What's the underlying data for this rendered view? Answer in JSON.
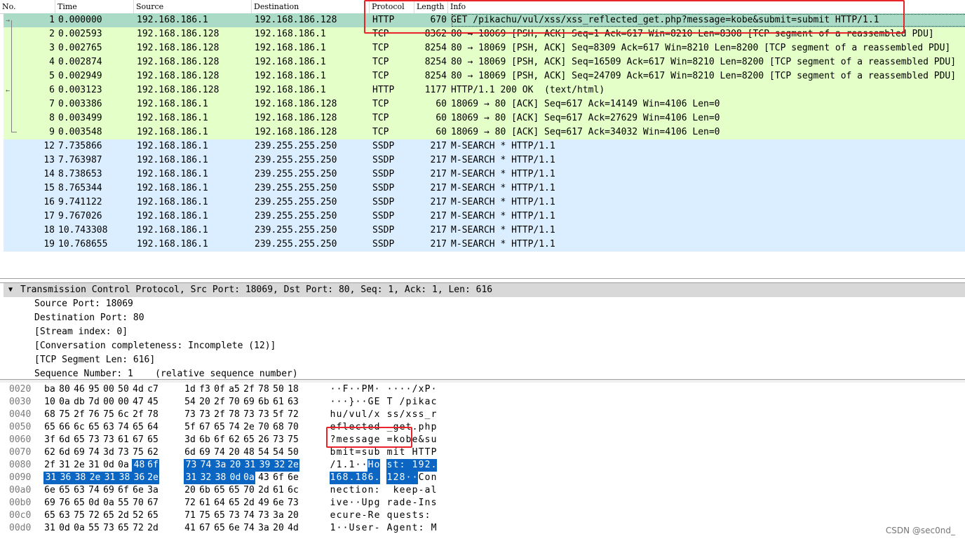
{
  "packet_list": {
    "columns": [
      "No.",
      "Time",
      "Source",
      "Destination",
      "Protocol",
      "Length",
      "Info"
    ],
    "rows": [
      {
        "no": "1",
        "time": "0.000000",
        "src": "192.168.186.1",
        "dst": "192.168.186.128",
        "proto": "HTTP",
        "len": "670",
        "info": "GET /pikachu/vul/xss/xss_reflected_get.php?message=kobe&submit=submit HTTP/1.1",
        "kind": "http-sel"
      },
      {
        "no": "2",
        "time": "0.002593",
        "src": "192.168.186.128",
        "dst": "192.168.186.1",
        "proto": "TCP",
        "len": "8362",
        "info": "80 → 18069 [PSH, ACK] Seq=1 Ack=617 Win=8210 Len=8308 [TCP segment of a reassembled PDU]",
        "kind": "tcp"
      },
      {
        "no": "3",
        "time": "0.002765",
        "src": "192.168.186.128",
        "dst": "192.168.186.1",
        "proto": "TCP",
        "len": "8254",
        "info": "80 → 18069 [PSH, ACK] Seq=8309 Ack=617 Win=8210 Len=8200 [TCP segment of a reassembled PDU]",
        "kind": "tcp"
      },
      {
        "no": "4",
        "time": "0.002874",
        "src": "192.168.186.128",
        "dst": "192.168.186.1",
        "proto": "TCP",
        "len": "8254",
        "info": "80 → 18069 [PSH, ACK] Seq=16509 Ack=617 Win=8210 Len=8200 [TCP segment of a reassembled PDU]",
        "kind": "tcp"
      },
      {
        "no": "5",
        "time": "0.002949",
        "src": "192.168.186.128",
        "dst": "192.168.186.1",
        "proto": "TCP",
        "len": "8254",
        "info": "80 → 18069 [PSH, ACK] Seq=24709 Ack=617 Win=8210 Len=8200 [TCP segment of a reassembled PDU]",
        "kind": "tcp"
      },
      {
        "no": "6",
        "time": "0.003123",
        "src": "192.168.186.128",
        "dst": "192.168.186.1",
        "proto": "HTTP",
        "len": "1177",
        "info": "HTTP/1.1 200 OK  (text/html)",
        "kind": "tcp"
      },
      {
        "no": "7",
        "time": "0.003386",
        "src": "192.168.186.1",
        "dst": "192.168.186.128",
        "proto": "TCP",
        "len": "60",
        "info": "18069 → 80 [ACK] Seq=617 Ack=14149 Win=4106 Len=0",
        "kind": "tcp"
      },
      {
        "no": "8",
        "time": "0.003499",
        "src": "192.168.186.1",
        "dst": "192.168.186.128",
        "proto": "TCP",
        "len": "60",
        "info": "18069 → 80 [ACK] Seq=617 Ack=27629 Win=4106 Len=0",
        "kind": "tcp"
      },
      {
        "no": "9",
        "time": "0.003548",
        "src": "192.168.186.1",
        "dst": "192.168.186.128",
        "proto": "TCP",
        "len": "60",
        "info": "18069 → 80 [ACK] Seq=617 Ack=34032 Win=4106 Len=0",
        "kind": "tcp"
      },
      {
        "no": "12",
        "time": "7.735866",
        "src": "192.168.186.1",
        "dst": "239.255.255.250",
        "proto": "SSDP",
        "len": "217",
        "info": "M-SEARCH * HTTP/1.1",
        "kind": "ssdp"
      },
      {
        "no": "13",
        "time": "7.763987",
        "src": "192.168.186.1",
        "dst": "239.255.255.250",
        "proto": "SSDP",
        "len": "217",
        "info": "M-SEARCH * HTTP/1.1",
        "kind": "ssdp"
      },
      {
        "no": "14",
        "time": "8.738653",
        "src": "192.168.186.1",
        "dst": "239.255.255.250",
        "proto": "SSDP",
        "len": "217",
        "info": "M-SEARCH * HTTP/1.1",
        "kind": "ssdp"
      },
      {
        "no": "15",
        "time": "8.765344",
        "src": "192.168.186.1",
        "dst": "239.255.255.250",
        "proto": "SSDP",
        "len": "217",
        "info": "M-SEARCH * HTTP/1.1",
        "kind": "ssdp"
      },
      {
        "no": "16",
        "time": "9.741122",
        "src": "192.168.186.1",
        "dst": "239.255.255.250",
        "proto": "SSDP",
        "len": "217",
        "info": "M-SEARCH * HTTP/1.1",
        "kind": "ssdp"
      },
      {
        "no": "17",
        "time": "9.767026",
        "src": "192.168.186.1",
        "dst": "239.255.255.250",
        "proto": "SSDP",
        "len": "217",
        "info": "M-SEARCH * HTTP/1.1",
        "kind": "ssdp"
      },
      {
        "no": "18",
        "time": "10.743308",
        "src": "192.168.186.1",
        "dst": "239.255.255.250",
        "proto": "SSDP",
        "len": "217",
        "info": "M-SEARCH * HTTP/1.1",
        "kind": "ssdp"
      },
      {
        "no": "19",
        "time": "10.768655",
        "src": "192.168.186.1",
        "dst": "239.255.255.250",
        "proto": "SSDP",
        "len": "217",
        "info": "M-SEARCH * HTTP/1.1",
        "kind": "ssdp"
      }
    ]
  },
  "details": {
    "title": "Transmission Control Protocol, Src Port: 18069, Dst Port: 80, Seq: 1, Ack: 1, Len: 616",
    "expand_icon": "chevron-down-icon",
    "lines": [
      "Source Port: 18069",
      "Destination Port: 80",
      "[Stream index: 0]",
      "[Conversation completeness: Incomplete (12)]",
      "[TCP Segment Len: 616]",
      "Sequence Number: 1    (relative sequence number)"
    ]
  },
  "hex": {
    "rows": [
      {
        "off": "0020",
        "bytes": [
          "ba",
          "80",
          "46",
          "95",
          "00",
          "50",
          "4d",
          "c7",
          "1d",
          "f3",
          "0f",
          "a5",
          "2f",
          "78",
          "50",
          "18"
        ],
        "ascii": "··F··PM· ····/xP·"
      },
      {
        "off": "0030",
        "bytes": [
          "10",
          "0a",
          "db",
          "7d",
          "00",
          "00",
          "47",
          "45",
          "54",
          "20",
          "2f",
          "70",
          "69",
          "6b",
          "61",
          "63"
        ],
        "ascii": "···}··GE T /pikac"
      },
      {
        "off": "0040",
        "bytes": [
          "68",
          "75",
          "2f",
          "76",
          "75",
          "6c",
          "2f",
          "78",
          "73",
          "73",
          "2f",
          "78",
          "73",
          "73",
          "5f",
          "72"
        ],
        "ascii": "hu/vul/x ss/xss_r"
      },
      {
        "off": "0050",
        "bytes": [
          "65",
          "66",
          "6c",
          "65",
          "63",
          "74",
          "65",
          "64",
          "5f",
          "67",
          "65",
          "74",
          "2e",
          "70",
          "68",
          "70"
        ],
        "ascii": "eflected _get.php"
      },
      {
        "off": "0060",
        "bytes": [
          "3f",
          "6d",
          "65",
          "73",
          "73",
          "61",
          "67",
          "65",
          "3d",
          "6b",
          "6f",
          "62",
          "65",
          "26",
          "73",
          "75"
        ],
        "ascii": "?message =kobe&su"
      },
      {
        "off": "0070",
        "bytes": [
          "62",
          "6d",
          "69",
          "74",
          "3d",
          "73",
          "75",
          "62",
          "6d",
          "69",
          "74",
          "20",
          "48",
          "54",
          "54",
          "50"
        ],
        "ascii": "bmit=sub mit HTTP"
      },
      {
        "off": "0080",
        "bytes": [
          "2f",
          "31",
          "2e",
          "31",
          "0d",
          "0a",
          "48",
          "6f",
          "73",
          "74",
          "3a",
          "20",
          "31",
          "39",
          "32",
          "2e"
        ],
        "ascii": "/1.1··Ho st: 192."
      },
      {
        "off": "0090",
        "bytes": [
          "31",
          "36",
          "38",
          "2e",
          "31",
          "38",
          "36",
          "2e",
          "31",
          "32",
          "38",
          "0d",
          "0a",
          "43",
          "6f",
          "6e"
        ],
        "ascii": "168.186. 128··Con"
      },
      {
        "off": "00a0",
        "bytes": [
          "6e",
          "65",
          "63",
          "74",
          "69",
          "6f",
          "6e",
          "3a",
          "20",
          "6b",
          "65",
          "65",
          "70",
          "2d",
          "61",
          "6c"
        ],
        "ascii": "nection:  keep-al"
      },
      {
        "off": "00b0",
        "bytes": [
          "69",
          "76",
          "65",
          "0d",
          "0a",
          "55",
          "70",
          "67",
          "72",
          "61",
          "64",
          "65",
          "2d",
          "49",
          "6e",
          "73"
        ],
        "ascii": "ive··Upg rade-Ins"
      },
      {
        "off": "00c0",
        "bytes": [
          "65",
          "63",
          "75",
          "72",
          "65",
          "2d",
          "52",
          "65",
          "71",
          "75",
          "65",
          "73",
          "74",
          "73",
          "3a",
          "20"
        ],
        "ascii": "ecure-Re quests: "
      },
      {
        "off": "00d0",
        "bytes": [
          "31",
          "0d",
          "0a",
          "55",
          "73",
          "65",
          "72",
          "2d",
          "41",
          "67",
          "65",
          "6e",
          "74",
          "3a",
          "20",
          "4d"
        ],
        "ascii": "1··User- Agent: M"
      }
    ]
  },
  "colors": {
    "http_selected": "#a9dbc6",
    "tcp": "#e4ffc7",
    "ssdp": "#daeeff",
    "hex_highlight": "#0b66c3",
    "annotation": "#e8242a"
  },
  "watermark": "CSDN @sec0nd_"
}
